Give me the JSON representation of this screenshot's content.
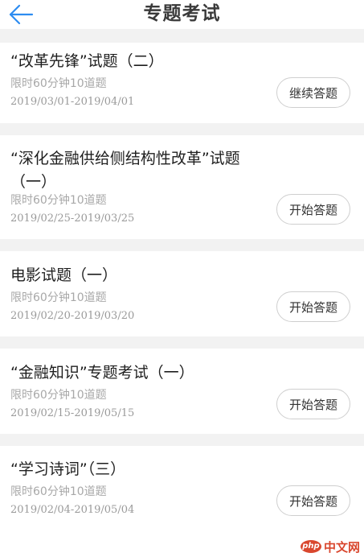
{
  "header": {
    "title": "专题考试",
    "back_icon": "arrow-left-icon",
    "accent_color": "#2d8cf0"
  },
  "cards": [
    {
      "title": "“改革先锋”试题（二）",
      "limit": "限时60分钟10道题",
      "date_range": "2019/03/01-2019/04/01",
      "button_label": "继续答题"
    },
    {
      "title": "“深化金融供给侧结构性改革”试题（一）",
      "limit": "限时60分钟10道题",
      "date_range": "2019/02/25-2019/03/25",
      "button_label": "开始答题"
    },
    {
      "title": "电影试题（一）",
      "limit": "限时60分钟10道题",
      "date_range": "2019/02/20-2019/03/20",
      "button_label": "开始答题"
    },
    {
      "title": "“金融知识”专题考试（一）",
      "limit": "限时60分钟10道题",
      "date_range": "2019/02/15-2019/05/15",
      "button_label": "开始答题"
    },
    {
      "title": "“学习诗词”（三）",
      "limit": "限时60分钟10道题",
      "date_range": "2019/02/04-2019/05/04",
      "button_label": "开始答题"
    }
  ],
  "watermark": {
    "logo": "php",
    "text": "中文网",
    "color": "#d9472e"
  }
}
